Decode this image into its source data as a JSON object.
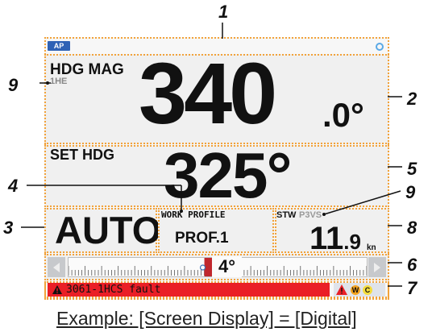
{
  "top_bar": {
    "ap_badge": "AP",
    "icon": "gear-indicator-icon"
  },
  "heading": {
    "title": "HDG MAG",
    "sensor": "1HE",
    "value": "340",
    "decimal": ".0°"
  },
  "set_heading": {
    "title": "SET HDG",
    "value": "325°"
  },
  "mode": {
    "value": "AUTO"
  },
  "profile": {
    "title": "WORK PROFILE",
    "value": "PROF.1"
  },
  "stw": {
    "title": "STW",
    "sensor": "P3VS",
    "value": "11",
    "decimal": ".9",
    "unit": "kn"
  },
  "rudder": {
    "value": "4°",
    "level": 4
  },
  "alert": {
    "text": "3061-1HCS fault",
    "icons": [
      "alert-triangle-icon",
      "warning-icon",
      "caution-icon"
    ],
    "icon_labels": [
      "W",
      "C"
    ]
  },
  "callouts": [
    "1",
    "2",
    "3",
    "4",
    "5",
    "6",
    "7",
    "8",
    "9",
    "9"
  ],
  "caption": "Example: [Screen Display] = [Digital]",
  "colors": {
    "region_border": "#f2a23a",
    "alert_bar": "#ea1f26",
    "ap_badge": "#2f62b5",
    "rudder_marker": "#c0272d"
  }
}
